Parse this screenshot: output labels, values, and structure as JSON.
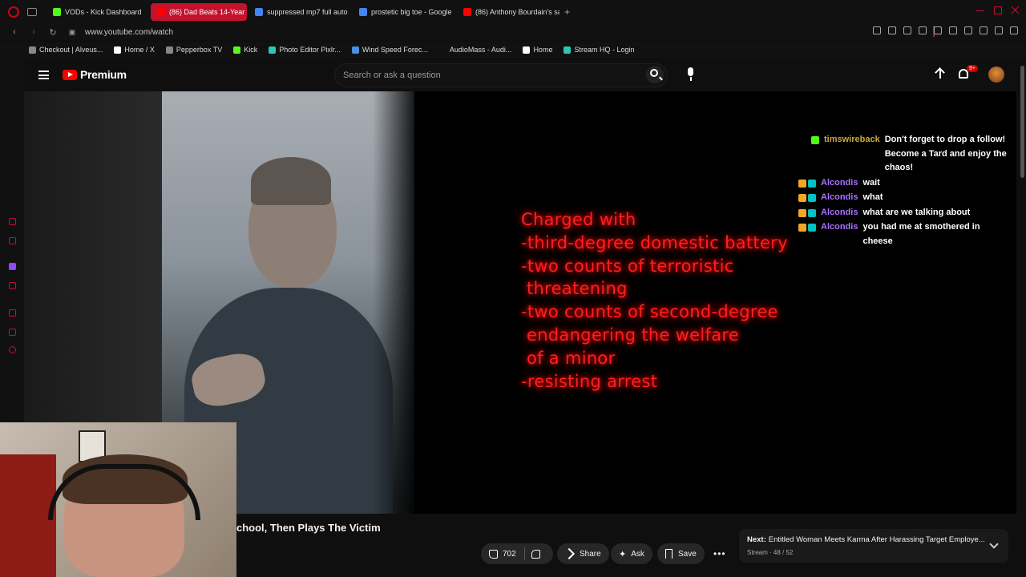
{
  "browser": {
    "tabs": [
      {
        "title": "VODs - Kick Dashboard",
        "color": "#53fc18"
      },
      {
        "title": "(86) Dad Beats 14-Year",
        "color": "#ff0000",
        "active": true
      },
      {
        "title": "suppressed mp7 full auto",
        "color": "#4285f4"
      },
      {
        "title": "prostetic big toe - Google",
        "color": "#4285f4"
      },
      {
        "title": "(86) Anthony Bourdain's sa",
        "color": "#ff0000"
      }
    ],
    "new_tab": "+",
    "url": "www.youtube.com/watch",
    "bookmarks": [
      {
        "label": "Checkout | Alveus...",
        "color": "#888"
      },
      {
        "label": "Home / X",
        "color": "#fff"
      },
      {
        "label": "Pepperbox TV",
        "color": "#888"
      },
      {
        "label": "Kick",
        "color": "#53fc18"
      },
      {
        "label": "Photo Editor Pixlr...",
        "color": "#2ec4b6"
      },
      {
        "label": "Wind Speed Forec...",
        "color": "#4a90e2"
      },
      {
        "label": "AudioMass - Audi...",
        "color": "#111"
      },
      {
        "label": "Home",
        "color": "#fff"
      },
      {
        "label": "Stream HQ - Login",
        "color": "#2ec4b6"
      }
    ]
  },
  "youtube": {
    "logo_text": "Premium",
    "search_placeholder": "Search or ask a question",
    "notifications_badge": "9+"
  },
  "video": {
    "overlay_text": "Charged with\n-third-degree domestic battery\n-two counts of terroristic\n threatening\n-two counts of second-degree\n endangering the welfare\n of a minor\n-resisting arrest",
    "chat": [
      {
        "user": "timswireback",
        "user_color": "#c8a93c",
        "text": "Don't forget to drop a follow! Become a Tard and enjoy the chaos!",
        "badges": [
          "#53fc18"
        ]
      },
      {
        "user": "Alcondis",
        "user_color": "#a970ff",
        "text": "wait",
        "badges": [
          "#f5a623",
          "#00c2c7"
        ]
      },
      {
        "user": "Alcondis",
        "user_color": "#a970ff",
        "text": "what",
        "badges": [
          "#f5a623",
          "#00c2c7"
        ]
      },
      {
        "user": "Alcondis",
        "user_color": "#a970ff",
        "text": "what are we talking about",
        "badges": [
          "#f5a623",
          "#00c2c7"
        ]
      },
      {
        "user": "Alcondis",
        "user_color": "#a970ff",
        "text": "you had me at smothered in cheese",
        "badges": [
          "#f5a623",
          "#00c2c7"
        ]
      }
    ]
  },
  "below_video": {
    "title": "chool, Then Plays The Victim",
    "likes": "702",
    "share": "Share",
    "ask": "Ask",
    "save": "Save",
    "more": "•••"
  },
  "next_up": {
    "label": "Next:",
    "title": "Entitled Woman Meets Karma After Harassing Target Employe...",
    "meta": "Stream · 48 / 52"
  }
}
